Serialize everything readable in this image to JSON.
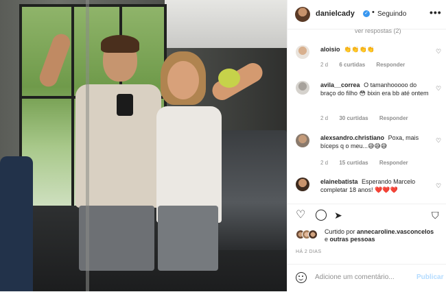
{
  "header": {
    "username": "danielcady",
    "verified_mark": "✓",
    "separator": "•",
    "follow_status": "Seguindo",
    "more_icon": "more-horizontal-icon"
  },
  "cut_off_text": "ver respostas (2)",
  "comments": [
    {
      "username": "aloisio",
      "text": "👏👏👏👏",
      "age": "2 d",
      "likes": "6 curtidas",
      "reply": "Responder"
    },
    {
      "username": "avila__correa",
      "text": "O tamanhooooo do braço do filho 😳 bixin era bb até ontem",
      "age": "2 d",
      "likes": "30 curtidas",
      "reply": "Responder"
    },
    {
      "username": "alexsandro.christiano",
      "text": "Poxa, mais bíceps q o meu...😅😅😅",
      "age": "2 d",
      "likes": "15 curtidas",
      "reply": "Responder"
    },
    {
      "username": "elainebatista",
      "text": "Esperando Marcelo completar 18 anos! ❤️❤️❤️",
      "age": "",
      "likes": "",
      "reply": ""
    }
  ],
  "actions": {
    "like_icon": "heart-icon",
    "comment_icon": "comment-icon",
    "share_icon": "share-icon",
    "save_icon": "bookmark-icon"
  },
  "likes": {
    "prefix": "Curtido por",
    "user": "annecaroline.vasconcelos",
    "connector": "e",
    "others": "outras pessoas"
  },
  "time_ago": "HÁ 2 DIAS",
  "add_comment": {
    "placeholder": "Adicione um comentário...",
    "publish_label": "Publicar",
    "emoji_icon": "smile-icon"
  },
  "colors": {
    "verified": "#3897f0",
    "publish_disabled": "#b3dbff",
    "secondary_text": "#8e8e8e"
  }
}
